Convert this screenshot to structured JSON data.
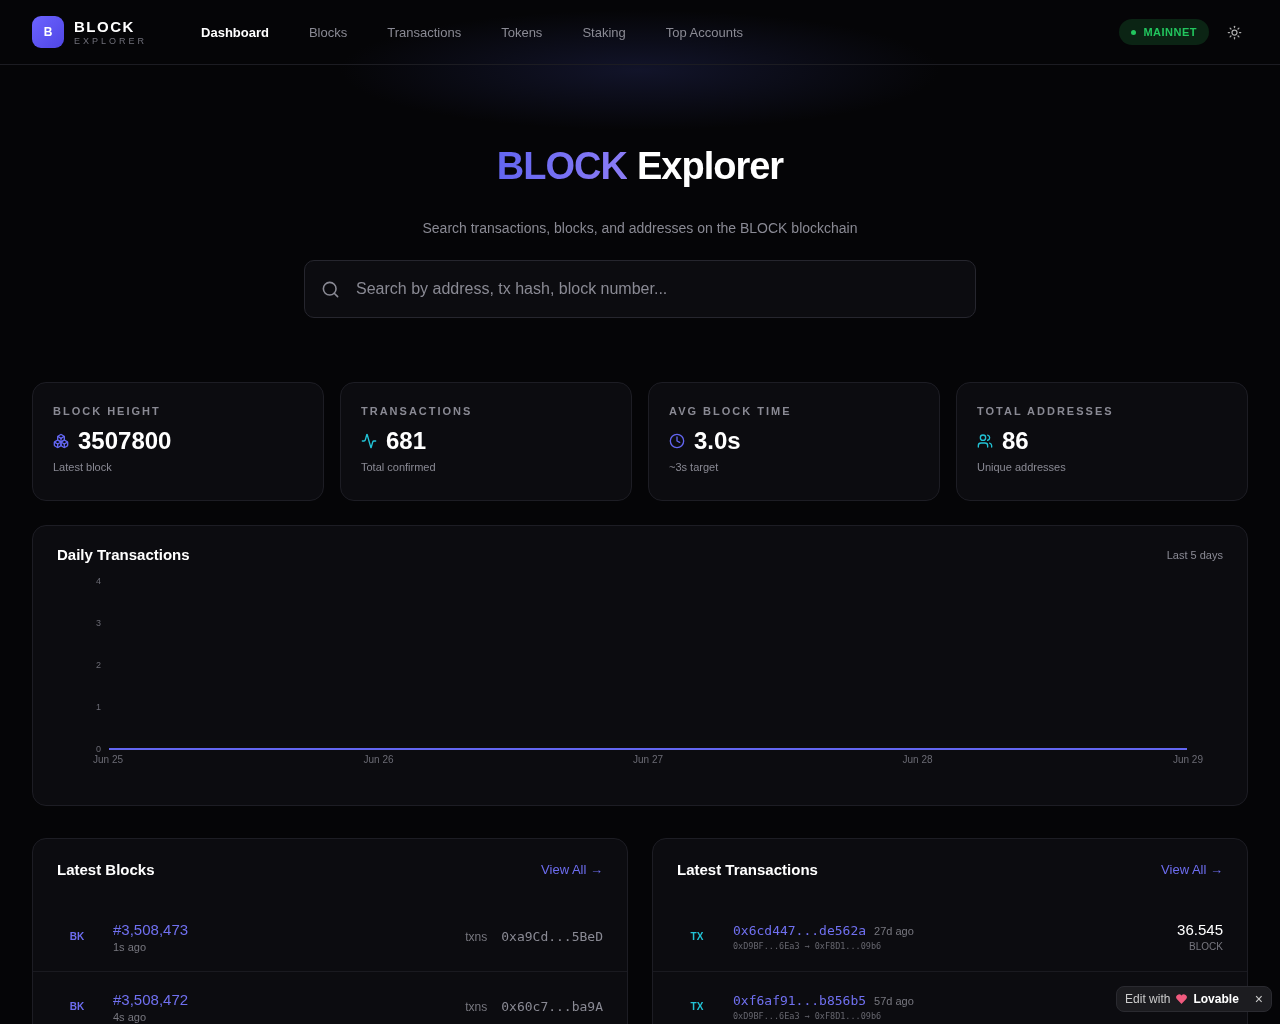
{
  "header": {
    "logo_letter": "B",
    "brand": "BLOCK",
    "brand_sub": "EXPLORER",
    "nav": [
      {
        "label": "Dashboard",
        "selected": true
      },
      {
        "label": "Blocks",
        "selected": false
      },
      {
        "label": "Transactions",
        "selected": false
      },
      {
        "label": "Tokens",
        "selected": false
      },
      {
        "label": "Staking",
        "selected": false
      },
      {
        "label": "Top Accounts",
        "selected": false
      }
    ],
    "network": "MAINNET"
  },
  "hero": {
    "title_accent": "BLOCK",
    "title_rest": "Explorer",
    "subtitle": "Search transactions, blocks, and addresses on the BLOCK blockchain",
    "search": {
      "placeholder": "Search by address, tx hash, block number..."
    }
  },
  "stats": [
    {
      "kind": "blocks",
      "label": "BLOCK HEIGHT",
      "value": "3507800",
      "note": "Latest block",
      "color": "#6366f1"
    },
    {
      "kind": "activity",
      "label": "TRANSACTIONS",
      "value": "681",
      "note": "Total confirmed",
      "color": "#22c3d6"
    },
    {
      "kind": "clock",
      "label": "AVG BLOCK TIME",
      "value": "3.0s",
      "note": "~3s target",
      "color": "#6366f1"
    },
    {
      "kind": "users",
      "label": "TOTAL ADDRESSES",
      "value": "86",
      "note": "Unique addresses",
      "color": "#22c3d6"
    }
  ],
  "daily": {
    "title": "Daily Transactions",
    "range": "Last 5 days",
    "chart_data": {
      "type": "line",
      "categories": [
        "Jun 25",
        "Jun 26",
        "Jun 27",
        "Jun 28",
        "Jun 29"
      ],
      "series": [
        {
          "color": "#6366f1",
          "values": [
            0,
            0,
            0,
            0,
            0
          ]
        }
      ],
      "ylim": [
        0,
        4
      ],
      "yticks": [
        0,
        1,
        2,
        3,
        4
      ]
    }
  },
  "latest_blocks": {
    "title": "Latest Blocks",
    "view_all": "View All →",
    "rows": [
      {
        "badge": "BK",
        "number": "#3,508,473",
        "age": "1s ago",
        "txns_label": "txns",
        "miner": "0xa9Cd...5BeD"
      },
      {
        "badge": "BK",
        "number": "#3,508,472",
        "age": "4s ago",
        "txns_label": "txns",
        "miner": "0x60c7...ba9A"
      }
    ]
  },
  "latest_transactions": {
    "title": "Latest Transactions",
    "view_all": "View All →",
    "rows": [
      {
        "badge": "TX",
        "hash": "0x6cd447...de562a",
        "age": "27d ago",
        "from": "0xD9BF...6Ea3",
        "arrow": "→",
        "to": "0xF8D1...09b6",
        "amount": "36.545",
        "unit": "BLOCK"
      },
      {
        "badge": "TX",
        "hash": "0xf6af91...b856b5",
        "age": "57d ago",
        "from": "0xD9BF...6Ea3",
        "arrow": "→",
        "to": "0xF8D1...09b6"
      }
    ]
  },
  "badge": {
    "prefix": "Edit with",
    "brand": "Lovable",
    "close": "×"
  }
}
